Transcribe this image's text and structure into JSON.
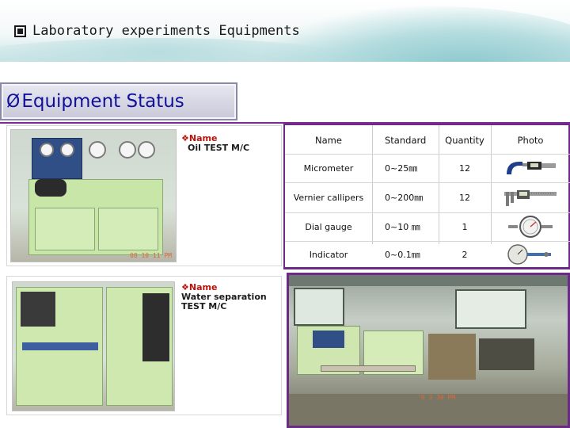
{
  "header": {
    "title": "Laboratory experiments Equipments",
    "icon": "square-bullet-icon"
  },
  "section": {
    "arrow": "Ø",
    "title": "Equipment Status"
  },
  "cards": [
    {
      "name_label": "❖Name",
      "name_value": "Oil TEST M/C",
      "photo_stamp": "08 10 11 PM"
    },
    {
      "name_label": "❖Name",
      "name_value": "Water separation TEST M/C"
    }
  ],
  "table": {
    "headers": [
      "Name",
      "Standard",
      "Quantity",
      "Photo"
    ],
    "rows": [
      {
        "name": "Micrometer",
        "standard": "0~25㎜",
        "quantity": "12",
        "photo_icon": "micrometer-icon"
      },
      {
        "name": "Vernier callipers",
        "standard": "0~200㎜",
        "quantity": "12",
        "photo_icon": "vernier-caliper-icon"
      },
      {
        "name": "Dial gauge",
        "standard": "0~10 ㎜",
        "quantity": "1",
        "photo_icon": "dial-gauge-icon"
      },
      {
        "name": "Indicator",
        "standard": "0~0.1㎜",
        "quantity": "2",
        "photo_icon": "dial-indicator-icon"
      }
    ]
  },
  "lab_photo": {
    "stamp": "'0 3 30 PM"
  },
  "colors": {
    "accent_purple": "#6b2a86",
    "banner_text": "#10109a",
    "name_label": "#b8140e"
  }
}
